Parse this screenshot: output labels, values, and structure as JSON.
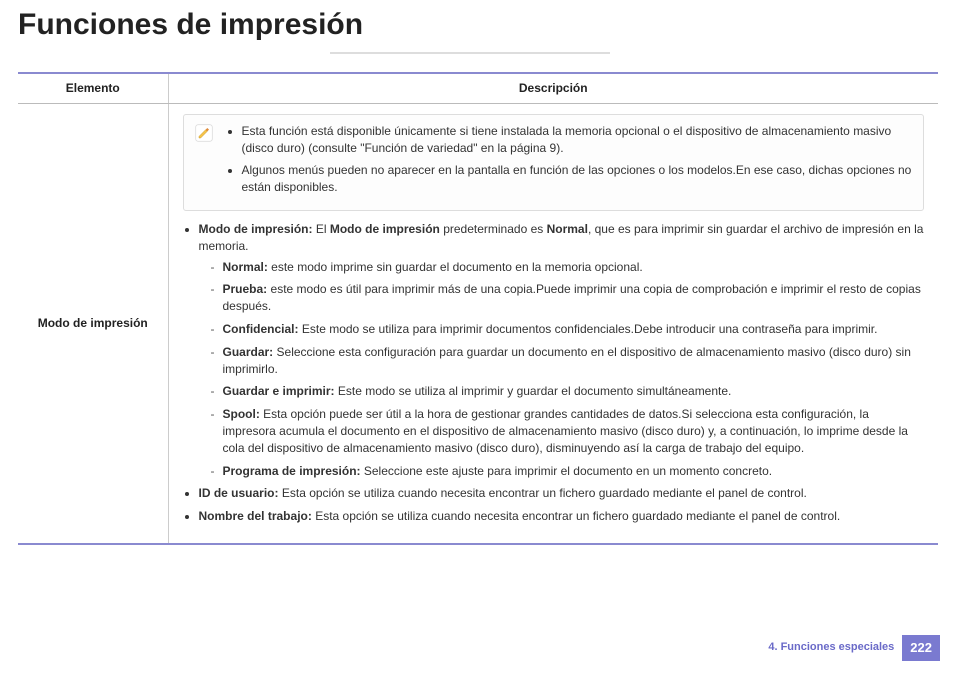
{
  "title": "Funciones de impresión",
  "table": {
    "header": {
      "element": "Elemento",
      "description": "Descripción"
    },
    "row_label": "Modo de impresión",
    "notes": [
      "Esta función está disponible únicamente si tiene instalada la memoria opcional o el dispositivo de almacenamiento masivo (disco duro) (consulte \"Función de variedad\" en la página 9).",
      "Algunos menús pueden no aparecer en la pantalla en función de las opciones o los modelos.En ese caso, dichas opciones no están disponibles."
    ],
    "item1": {
      "label": "Modo de impresión:",
      "pre": " El ",
      "bold2": "Modo de impresión",
      "mid": " predeterminado es ",
      "bold3": "Normal",
      "rest": ", que es para imprimir sin guardar el archivo de impresión en la memoria.",
      "subs": [
        {
          "label": "Normal:",
          "text": " este modo imprime sin guardar el documento en la memoria opcional."
        },
        {
          "label": "Prueba:",
          "text": " este modo es útil para imprimir más de una copia.Puede imprimir una copia de comprobación e imprimir el resto de copias después."
        },
        {
          "label": "Confidencial:",
          "text": " Este modo se utiliza para imprimir documentos confidenciales.Debe introducir una contraseña para imprimir."
        },
        {
          "label": "Guardar:",
          "text": " Seleccione esta configuración para guardar un documento en el dispositivo de almacenamiento masivo (disco duro) sin imprimirlo."
        },
        {
          "label": "Guardar e imprimir:",
          "text": " Este modo se utiliza al imprimir y guardar el documento simultáneamente."
        },
        {
          "label": "Spool:",
          "text": " Esta opción puede ser útil a la hora de gestionar grandes cantidades de datos.Si selecciona esta configuración, la impresora acumula el documento en el dispositivo de almacenamiento masivo (disco duro) y, a continuación, lo imprime desde la cola del dispositivo de almacenamiento masivo (disco duro), disminuyendo así la carga de trabajo del equipo."
        },
        {
          "label": "Programa de impresión:",
          "text": " Seleccione este ajuste para imprimir el documento en un momento concreto."
        }
      ]
    },
    "item2": {
      "label": "ID de usuario:",
      "text": " Esta opción se utiliza cuando necesita encontrar un fichero guardado mediante el panel de control."
    },
    "item3": {
      "label": "Nombre del trabajo:",
      "text": " Esta opción se utiliza cuando necesita encontrar un fichero guardado mediante el panel de control."
    }
  },
  "footer": {
    "chapter": "4.  Funciones especiales",
    "page": "222"
  }
}
